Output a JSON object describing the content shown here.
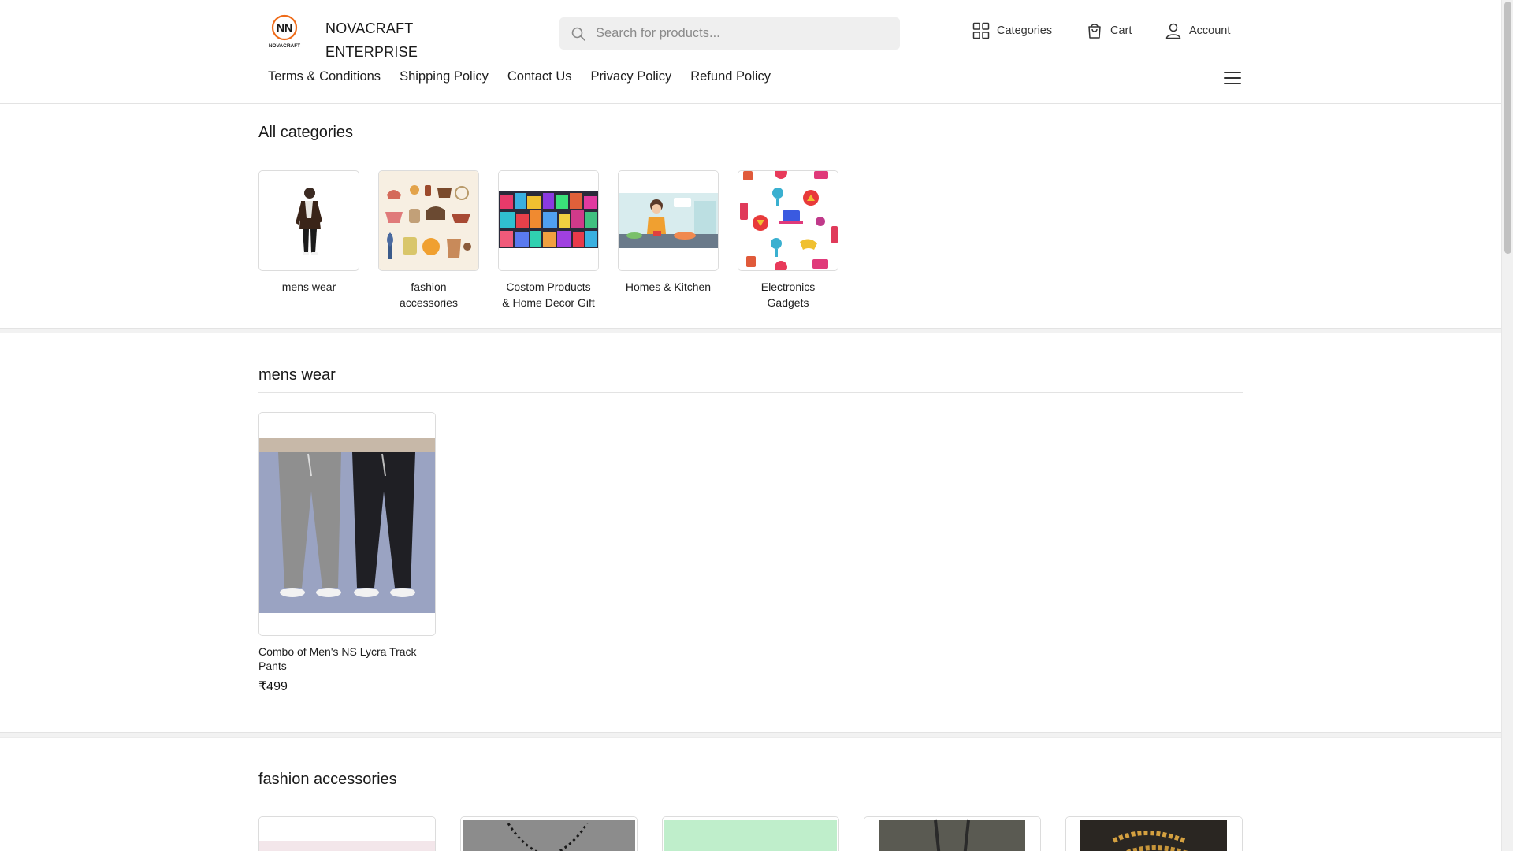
{
  "brand": {
    "line1": "NOVACRAFT",
    "line2": "ENTERPRISE",
    "logo_text": "NN",
    "logo_sub": "NOVACRAFT"
  },
  "search": {
    "placeholder": "Search for products..."
  },
  "header_actions": {
    "categories": "Categories",
    "cart": "Cart",
    "account": "Account"
  },
  "nav": [
    "Terms & Conditions",
    "Shipping Policy",
    "Contact Us",
    "Privacy Policy",
    "Refund Policy"
  ],
  "all_categories": {
    "title": "All categories",
    "items": [
      {
        "line1": "mens wear",
        "line2": ""
      },
      {
        "line1": "fashion",
        "line2": "accessories"
      },
      {
        "line1": "Costom Products",
        "line2": "& Home Decor Gift"
      },
      {
        "line1": "Homes & Kitchen",
        "line2": ""
      },
      {
        "line1": "Electronics",
        "line2": "Gadgets"
      }
    ]
  },
  "mens_wear": {
    "title": "mens wear",
    "products": [
      {
        "name_line1": "Combo of Men's NS Lycra Track",
        "name_line2": "Pants",
        "price": "₹499"
      }
    ]
  },
  "fashion_accessories": {
    "title": "fashion accessories"
  },
  "colors": {
    "accent": "#ef6c1a",
    "text": "#1f1f1f",
    "muted": "#8a8a8a",
    "border": "#dcdcdc",
    "search_bg": "#efefef"
  }
}
